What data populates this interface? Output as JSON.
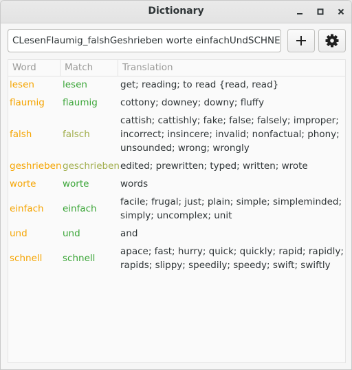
{
  "window": {
    "title": "Dictionary"
  },
  "search": {
    "value": "CLesenFlaumig_falshGeshrieben worte einfachUndSCHNELL"
  },
  "table": {
    "headers": {
      "word": "Word",
      "match": "Match",
      "translation": "Translation"
    },
    "rows": [
      {
        "word": "lesen",
        "match": "lesen",
        "translation": "get; reading; to read {read, read}"
      },
      {
        "word": "flaumig",
        "match": "flaumig",
        "translation": "cottony; downey; downy; fluffy"
      },
      {
        "word": "falsh",
        "match": "falsch",
        "translation": "cattish; cattishly; fake; false; falsely; improper; incorrect; insincere; invalid; nonfactual; phony; unsounded; wrong; wrongly"
      },
      {
        "word": "geshrieben",
        "match": "geschrieben",
        "translation": "edited; prewritten; typed; written; wrote"
      },
      {
        "word": "worte",
        "match": "worte",
        "translation": "words"
      },
      {
        "word": "einfach",
        "match": "einfach",
        "translation": "facile; frugal; just; plain; simple; simpleminded; simply; uncomplex; unit"
      },
      {
        "word": "und",
        "match": "und",
        "translation": "and"
      },
      {
        "word": "schnell",
        "match": "schnell",
        "translation": "apace; fast; hurry; quick; quickly; rapid; rapidly; rapids; slippy; speedily; speedy; swift; swiftly"
      }
    ]
  },
  "colors": {
    "word": "#f5a400",
    "match_exact": "#3aa537",
    "match_fuzzy": "#a0ad4a"
  },
  "icons": {
    "minimize": "minimize-icon",
    "maximize": "maximize-icon",
    "close": "close-icon",
    "add": "plus-icon",
    "settings": "gear-icon"
  }
}
